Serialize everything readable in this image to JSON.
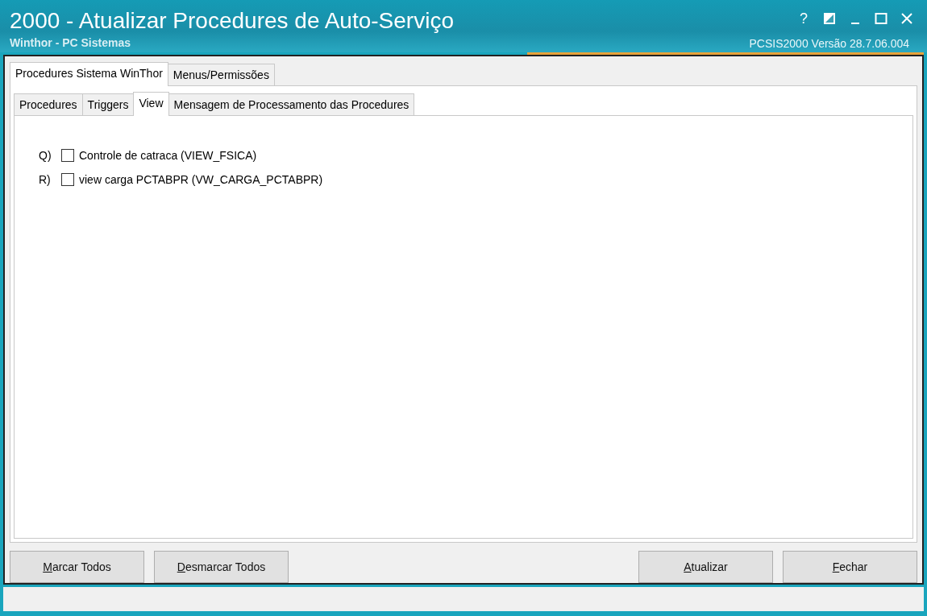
{
  "window": {
    "title": "2000 - Atualizar Procedures de Auto-Serviço",
    "subtitle": "Winthor - PC Sistemas",
    "version": "PCSIS2000  Versão  28.7.06.004",
    "controls": [
      {
        "kind": "help",
        "label": "?"
      },
      {
        "kind": "theme"
      },
      {
        "kind": "minimize"
      },
      {
        "kind": "maximize"
      },
      {
        "kind": "close"
      }
    ]
  },
  "tabs": [
    {
      "label": "Procedures Sistema WinThor",
      "selected": true
    },
    {
      "label": "Menus/Permissões",
      "selected": false
    }
  ],
  "subtabs": [
    {
      "label": "Procedures",
      "selected": false
    },
    {
      "label": "Triggers",
      "selected": false
    },
    {
      "label": "View",
      "selected": true
    },
    {
      "label": "Mensagem de Processamento das Procedures",
      "selected": false
    }
  ],
  "items": [
    {
      "letter": "Q)",
      "label": "Controle de catraca (VIEW_FSICA)",
      "checked": false
    },
    {
      "letter": "R)",
      "label": "view carga PCTABPR (VW_CARGA_PCTABPR)",
      "checked": false
    }
  ],
  "left_buttons": [
    "Marcar Todos",
    "Desmarcar Todos"
  ],
  "right_buttons": [
    "Atualizar",
    "Fechar"
  ]
}
